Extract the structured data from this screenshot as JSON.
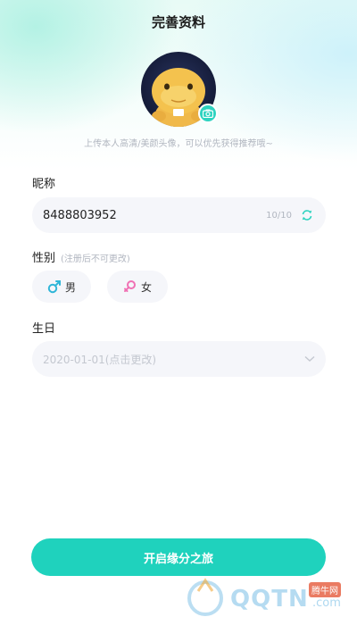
{
  "header": {
    "title": "完善资料"
  },
  "avatar": {
    "hint": "上传本人高清/美颜头像，可以优先获得推荐哦~",
    "camera_icon": "camera-icon"
  },
  "nickname": {
    "label": "昵称",
    "value": "8488803952",
    "count": "10/10",
    "refresh_icon": "refresh-icon"
  },
  "gender": {
    "label": "性别",
    "note": "(注册后不可更改)",
    "male_label": "男",
    "female_label": "女",
    "male_color": "#2fb6d8",
    "female_color": "#f071b4"
  },
  "birthday": {
    "label": "生日",
    "placeholder": "2020-01-01(点击更改)"
  },
  "submit": {
    "label": "开启缘分之旅"
  },
  "watermark": {
    "text": "QQTN",
    "suffix": ".com",
    "badge": "腾牛网"
  },
  "colors": {
    "accent": "#1fd2bd",
    "field_bg": "#f5f6fa",
    "hint": "#b1b6c0"
  }
}
